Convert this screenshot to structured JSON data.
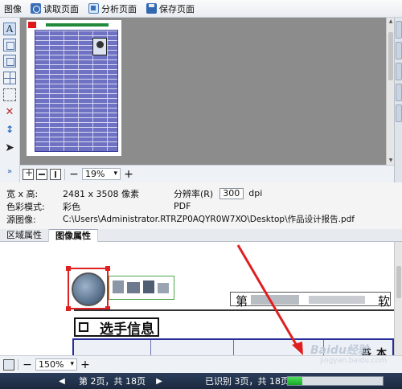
{
  "toolbar": {
    "title": "图像",
    "buttons": [
      {
        "label": "读取页面",
        "icon": "read-page-icon"
      },
      {
        "label": "分析页面",
        "icon": "analyze-page-icon"
      },
      {
        "label": "保存页面",
        "icon": "save-page-icon"
      }
    ]
  },
  "left_tools": [
    "text-area-tool-icon",
    "image-area-tool-icon",
    "picture-area-tool-icon",
    "table-area-tool-icon",
    "background-area-tool-icon",
    "delete-area-tool-icon",
    "sort-areas-tool-icon",
    "select-arrow-tool-icon",
    "expand-tools-icon"
  ],
  "zoom": {
    "value": "19%"
  },
  "properties": {
    "size_label": "宽 x 高:",
    "size_value": "2481 x 3508 像素",
    "dpi_label": "分辨率(R)",
    "dpi_value": "300",
    "dpi_unit": "dpi",
    "color_label": "色彩模式:",
    "color_value": "彩色",
    "format_value": "PDF",
    "source_label": "源图像:",
    "source_value": "C:\\Users\\Administrator.RTRZP0AQYR0W7XO\\Desktop\\作品设计报告.pdf"
  },
  "tabs": [
    {
      "label": "区域属性",
      "active": false
    },
    {
      "label": "图像属性",
      "active": true
    }
  ],
  "document": {
    "section_title": "选手信息",
    "basic_info": "基本信",
    "headline_right": "软",
    "headline_left": "第"
  },
  "bottom_zoom": {
    "value": "150%"
  },
  "pagebar": {
    "page_text": "第 2页，共 18页",
    "recognized_text": "已识别 3页，共 18页",
    "progress": 0.15
  },
  "watermark": {
    "main": "Baidu经验",
    "sub": "jingyan.baidu.com"
  },
  "colors": {
    "accent": "#3a6fb8",
    "selection_red": "#e02020",
    "selection_green": "#4ca64c",
    "form_blue": "#272f9a",
    "progress_green": "#17a82a"
  }
}
